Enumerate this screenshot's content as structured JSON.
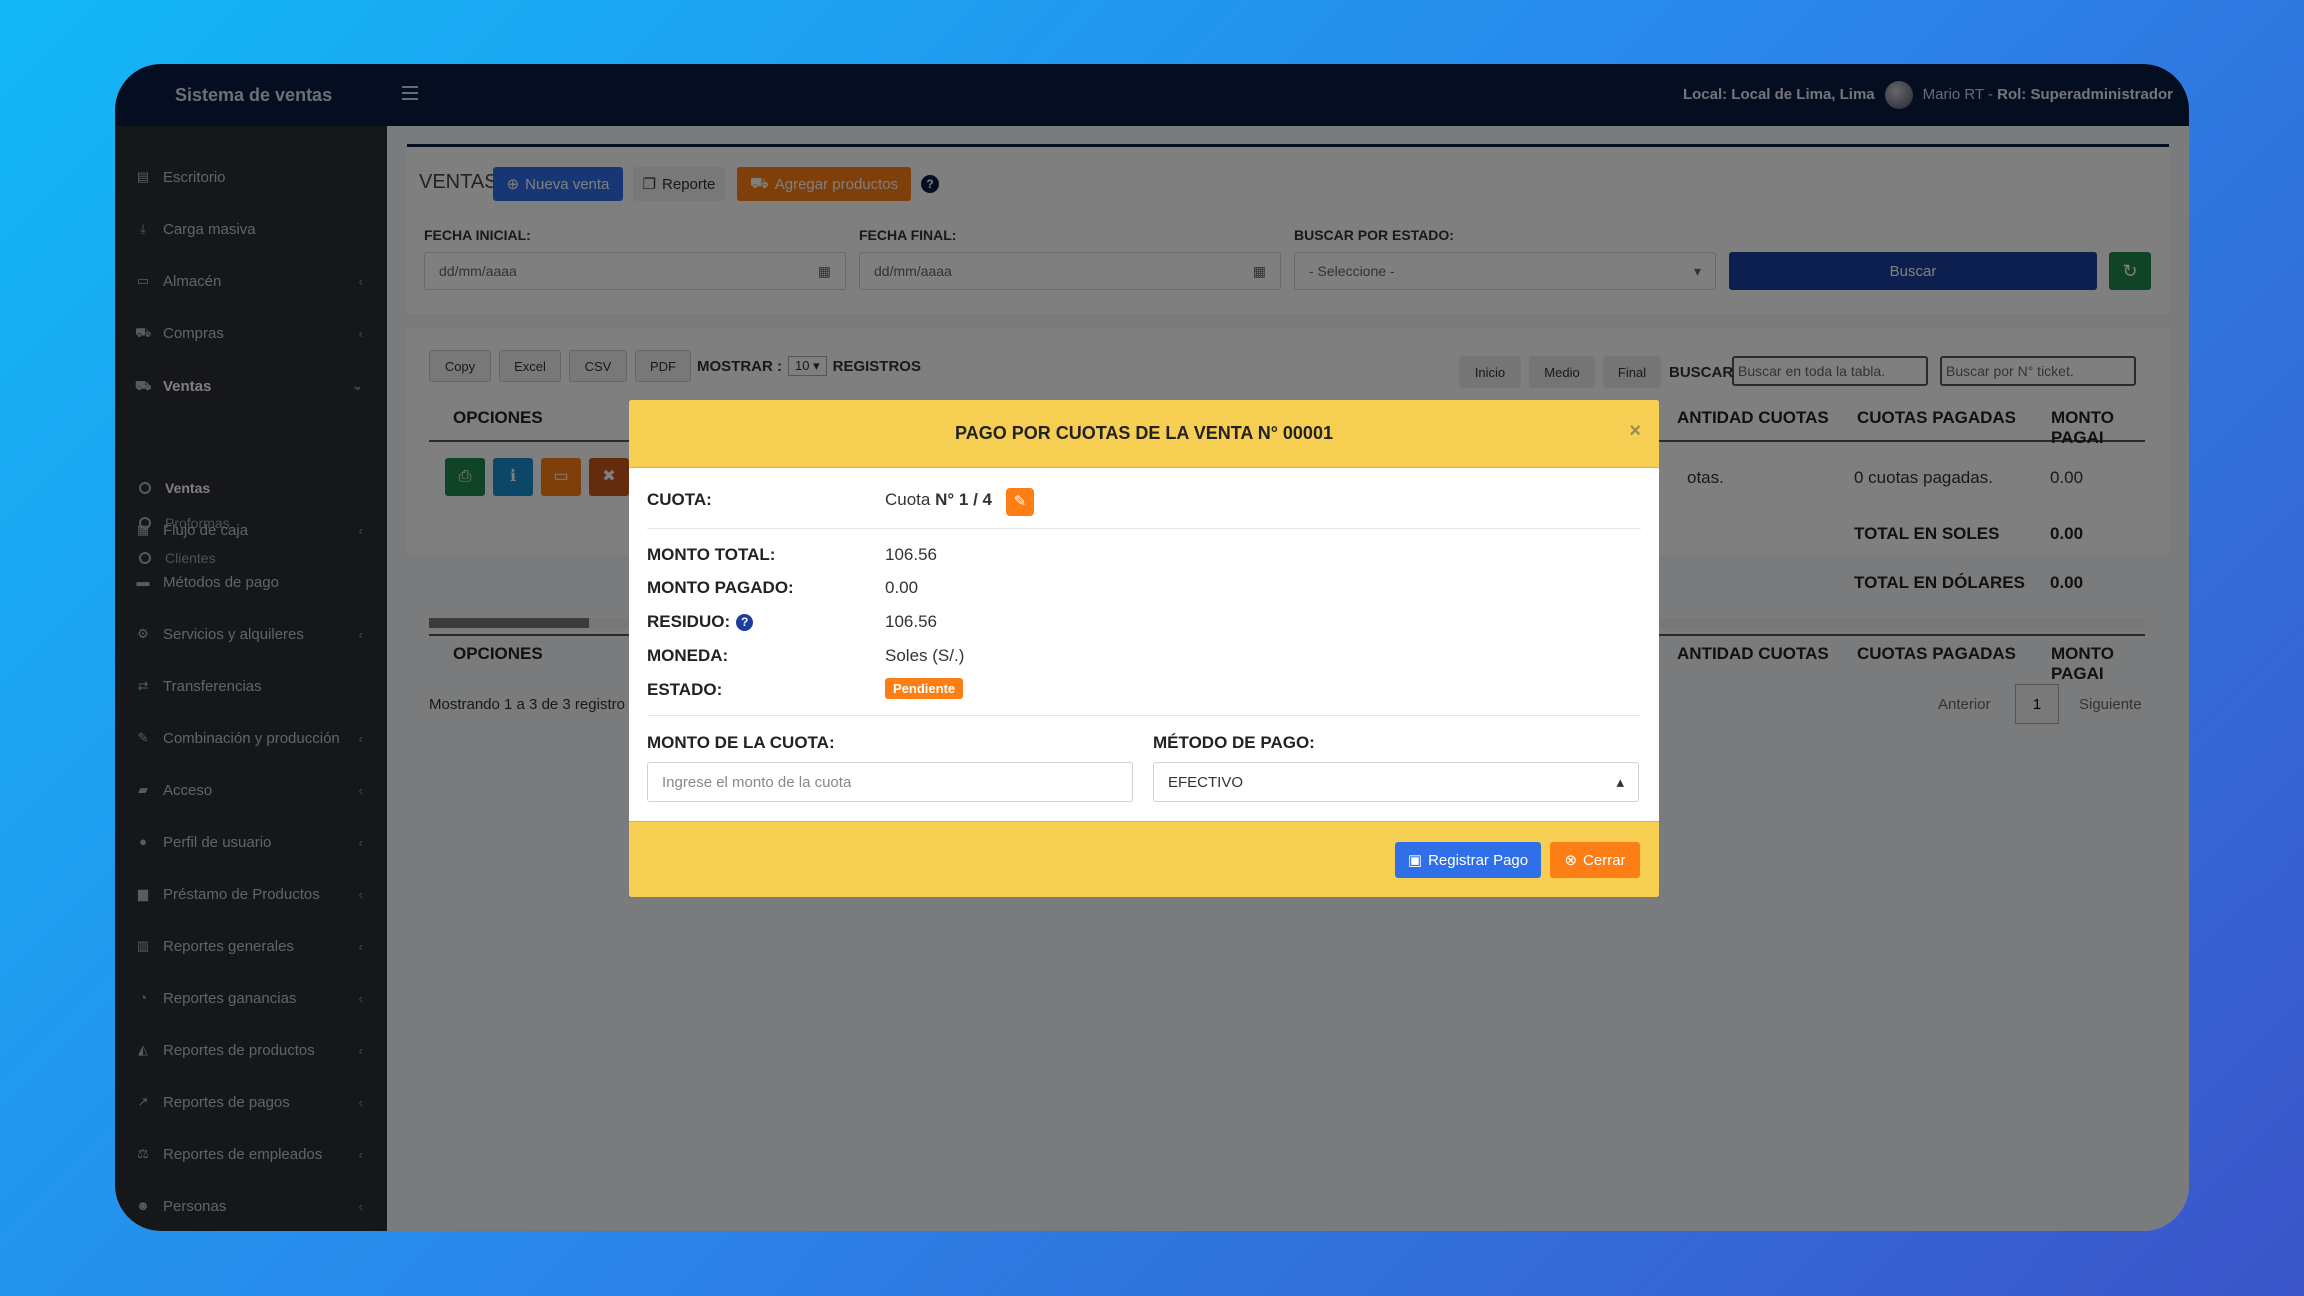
{
  "app": {
    "brand": "Sistema de ventas",
    "local_label": "Local: Local de Lima, Lima",
    "user_name": "Mario RT",
    "role_sep": " - ",
    "role": "Rol: Superadministrador"
  },
  "sidebar": {
    "items": [
      {
        "label": "Escritorio",
        "icon": "desktop-icon"
      },
      {
        "label": "Carga masiva",
        "icon": "download-icon"
      },
      {
        "label": "Almacén",
        "icon": "laptop-icon"
      },
      {
        "label": "Compras",
        "icon": "cart-icon"
      },
      {
        "label": "Ventas",
        "icon": "cart-icon"
      },
      {
        "label": "Flujo de caja",
        "icon": "cash-icon"
      },
      {
        "label": "Métodos de pago",
        "icon": "credit-card-icon"
      },
      {
        "label": "Servicios y alquileres",
        "icon": "cogs-icon"
      },
      {
        "label": "Transferencias",
        "icon": "exchange-icon"
      },
      {
        "label": "Combinación y producción",
        "icon": "tools-icon"
      },
      {
        "label": "Acceso",
        "icon": "folder-icon"
      },
      {
        "label": "Perfil de usuario",
        "icon": "user-icon"
      },
      {
        "label": "Préstamo de Productos",
        "icon": "truck-icon"
      },
      {
        "label": "Reportes generales",
        "icon": "bar-chart-icon"
      },
      {
        "label": "Reportes ganancias",
        "icon": "pie-chart-icon"
      },
      {
        "label": "Reportes de productos",
        "icon": "area-chart-icon"
      },
      {
        "label": "Reportes de pagos",
        "icon": "line-chart-icon"
      },
      {
        "label": "Reportes de empleados",
        "icon": "balance-icon"
      },
      {
        "label": "Personas",
        "icon": "users-icon"
      }
    ],
    "subitems": [
      "Ventas",
      "Proformas",
      "Clientes"
    ]
  },
  "header": {
    "title": "VENTAS",
    "new_sale": "Nueva venta",
    "report": "Reporte",
    "add_products": "Agregar productos",
    "help": "?"
  },
  "filters": {
    "date_start_label": "FECHA INICIAL:",
    "date_start_placeholder": "dd/mm/aaaa",
    "date_end_label": "FECHA FINAL:",
    "date_end_placeholder": "dd/mm/aaaa",
    "state_label": "BUSCAR POR ESTADO:",
    "state_value": "- Seleccione -",
    "search_button": "Buscar"
  },
  "table": {
    "export_buttons": [
      "Copy",
      "Excel",
      "CSV",
      "PDF"
    ],
    "show_label": "MOSTRAR :",
    "show_value": "10",
    "records_label": "REGISTROS",
    "nav_buttons": [
      "Inicio",
      "Medio",
      "Final"
    ],
    "search_label": "BUSCAR:",
    "search_placeholder": "Buscar en toda la tabla.",
    "ticket_placeholder": "Buscar por N° ticket.",
    "col_options": "OPCIONES",
    "col_qty": "ANTIDAD CUOTAS",
    "col_paid": "CUOTAS PAGADAS",
    "col_amount": "MONTO PAGAI",
    "row_qty": "otas.",
    "row_paid": "0 cuotas pagadas.",
    "row_amount": "0.00",
    "total_soles_label": "TOTAL EN SOLES",
    "total_soles": "0.00",
    "total_usd_label": "TOTAL EN DÓLARES",
    "total_usd": "0.00",
    "info": "Mostrando 1 a 3 de 3 registro",
    "prev": "Anterior",
    "page": "1",
    "next": "Siguiente"
  },
  "modal": {
    "title": "PAGO POR CUOTAS DE LA VENTA N° 00001",
    "close": "×",
    "cuota_label": "CUOTA:",
    "cuota_prefix": "Cuota",
    "cuota_value": "N° 1 / 4",
    "total_label": "MONTO TOTAL:",
    "total": "106.56",
    "paid_label": "MONTO PAGADO:",
    "paid": "0.00",
    "residue_label": "RESIDUO:",
    "residue": "106.56",
    "currency_label": "MONEDA:",
    "currency": "Soles (S/.)",
    "status_label": "ESTADO:",
    "status": "Pendiente",
    "amount_label": "MONTO DE LA CUOTA:",
    "amount_placeholder": "Ingrese el monto de la cuota",
    "method_label": "MÉTODO DE PAGO:",
    "method_value": "EFECTIVO",
    "register": "Registrar Pago",
    "cancel": "Cerrar"
  },
  "colors": {
    "topbar": "#0b1a43",
    "sidebar": "#2b2f34",
    "modal_header": "#f6cf52",
    "primary": "#2f6fe8",
    "orange": "#fd7e14",
    "green": "#1e8a4c"
  }
}
